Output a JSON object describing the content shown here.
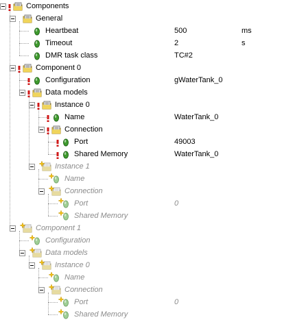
{
  "tree": [
    {
      "id": "components",
      "label": "Components",
      "level": 0,
      "type": "folder",
      "warn": true,
      "grey": false,
      "expanded": true
    },
    {
      "id": "general",
      "label": "General",
      "level": 1,
      "type": "folder",
      "warn": false,
      "grey": false,
      "expanded": true
    },
    {
      "id": "heartbeat",
      "label": "Heartbeat",
      "level": 2,
      "type": "leaf",
      "warn": false,
      "grey": false,
      "value": "500",
      "unit": "ms"
    },
    {
      "id": "timeout",
      "label": "Timeout",
      "level": 2,
      "type": "leaf",
      "warn": false,
      "grey": false,
      "value": "2",
      "unit": "s"
    },
    {
      "id": "dmr-task-class",
      "label": "DMR task class",
      "level": 2,
      "type": "leaf",
      "warn": false,
      "grey": false,
      "value": "TC#2"
    },
    {
      "id": "component-0",
      "label": "Component 0",
      "level": 1,
      "type": "folder",
      "warn": true,
      "grey": false,
      "expanded": true
    },
    {
      "id": "configuration-0",
      "label": "Configuration",
      "level": 2,
      "type": "leaf",
      "warn": true,
      "grey": false,
      "value": "gWaterTank_0"
    },
    {
      "id": "data-models-0",
      "label": "Data models",
      "level": 2,
      "type": "folder",
      "warn": true,
      "grey": false,
      "expanded": true
    },
    {
      "id": "instance-0",
      "label": "Instance 0",
      "level": 3,
      "type": "folder",
      "warn": true,
      "grey": false,
      "expanded": true
    },
    {
      "id": "name-0",
      "label": "Name",
      "level": 4,
      "type": "leaf",
      "warn": true,
      "grey": false,
      "value": "WaterTank_0"
    },
    {
      "id": "connection-0",
      "label": "Connection",
      "level": 4,
      "type": "folder",
      "warn": true,
      "grey": false,
      "expanded": true
    },
    {
      "id": "port-0",
      "label": "Port",
      "level": 5,
      "type": "leaf",
      "warn": true,
      "grey": false,
      "value": "49003"
    },
    {
      "id": "shared-memory-0",
      "label": "Shared Memory",
      "level": 5,
      "type": "leaf",
      "warn": true,
      "grey": false,
      "value": "WaterTank_0"
    },
    {
      "id": "instance-1",
      "label": "Instance 1",
      "level": 3,
      "type": "folder",
      "warn": false,
      "grey": true,
      "expanded": true
    },
    {
      "id": "name-1",
      "label": "Name",
      "level": 4,
      "type": "leaf",
      "warn": false,
      "grey": true
    },
    {
      "id": "connection-1",
      "label": "Connection",
      "level": 4,
      "type": "folder",
      "warn": false,
      "grey": true,
      "expanded": true
    },
    {
      "id": "port-1",
      "label": "Port",
      "level": 5,
      "type": "leaf",
      "warn": false,
      "grey": true,
      "value": "0"
    },
    {
      "id": "shared-memory-1",
      "label": "Shared Memory",
      "level": 5,
      "type": "leaf",
      "warn": false,
      "grey": true
    },
    {
      "id": "component-1",
      "label": "Component 1",
      "level": 1,
      "type": "folder",
      "warn": false,
      "grey": true,
      "expanded": true
    },
    {
      "id": "configuration-1",
      "label": "Configuration",
      "level": 2,
      "type": "leaf",
      "warn": false,
      "grey": true
    },
    {
      "id": "data-models-1",
      "label": "Data models",
      "level": 2,
      "type": "folder",
      "warn": false,
      "grey": true,
      "expanded": true
    },
    {
      "id": "instance-0-c1",
      "label": "Instance 0",
      "level": 3,
      "type": "folder",
      "warn": false,
      "grey": true,
      "expanded": true
    },
    {
      "id": "name-0-c1",
      "label": "Name",
      "level": 4,
      "type": "leaf",
      "warn": false,
      "grey": true
    },
    {
      "id": "connection-0-c1",
      "label": "Connection",
      "level": 4,
      "type": "folder",
      "warn": false,
      "grey": true,
      "expanded": true
    },
    {
      "id": "port-0-c1",
      "label": "Port",
      "level": 5,
      "type": "leaf",
      "warn": false,
      "grey": true,
      "value": "0"
    },
    {
      "id": "shared-memory-0-c1",
      "label": "Shared Memory",
      "level": 5,
      "type": "leaf",
      "warn": false,
      "grey": true
    }
  ],
  "colors": {
    "leaf_green": "#3f9b2e",
    "folder_yellow": "#f2d65a",
    "warn_red": "#d01818",
    "grey_text": "#8c8c8c"
  },
  "icons": {
    "folder": "parameter-folder-icon",
    "leaf": "parameter-leaf-icon",
    "warn": "warning-marker-icon",
    "new": "new-item-star-icon",
    "expander": "collapse-icon"
  }
}
